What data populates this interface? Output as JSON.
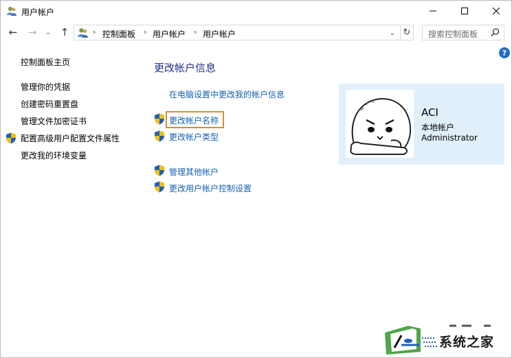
{
  "window": {
    "title": "用户帐户",
    "controls": {
      "minimize": "minimize-icon",
      "maximize": "maximize-icon",
      "close": "close-icon"
    }
  },
  "navigation": {
    "back": "←",
    "forward": "→",
    "recent": "⌄",
    "up": "↑",
    "breadcrumb": [
      "控制面板",
      "用户帐户",
      "用户帐户"
    ],
    "separator": "›",
    "dropdown": "⌄",
    "refresh": "↻"
  },
  "search": {
    "placeholder": "搜索控制面板"
  },
  "help": {
    "label": "?"
  },
  "sidebar": {
    "items": [
      {
        "label": "控制面板主页"
      },
      {
        "label": "管理你的凭据"
      },
      {
        "label": "创建密码重置盘"
      },
      {
        "label": "管理文件加密证书"
      },
      {
        "label": "配置高级用户配置文件属性",
        "icon": "shield-icon"
      },
      {
        "label": "更改我的环境变量"
      }
    ]
  },
  "main": {
    "heading": "更改帐户信息",
    "links": [
      {
        "label": "在电脑设置中更改我的帐户信息",
        "shield": false
      },
      {
        "label": "更改帐户名称",
        "shield": true,
        "highlighted": true
      },
      {
        "label": "更改帐户类型",
        "shield": true
      },
      {
        "label": "管理其他帐户",
        "shield": true
      },
      {
        "label": "更改用户帐户控制设置",
        "shield": true
      }
    ],
    "highlight_color": "#d88c3b"
  },
  "account": {
    "name": "ACI",
    "type": "本地帐户",
    "role": "Administrator",
    "card_color": "#e1effa"
  },
  "watermark": {
    "text": "系统之家"
  },
  "colors": {
    "link": "#1461b1",
    "heading": "#1e3287",
    "help": "#1f6fc5"
  }
}
